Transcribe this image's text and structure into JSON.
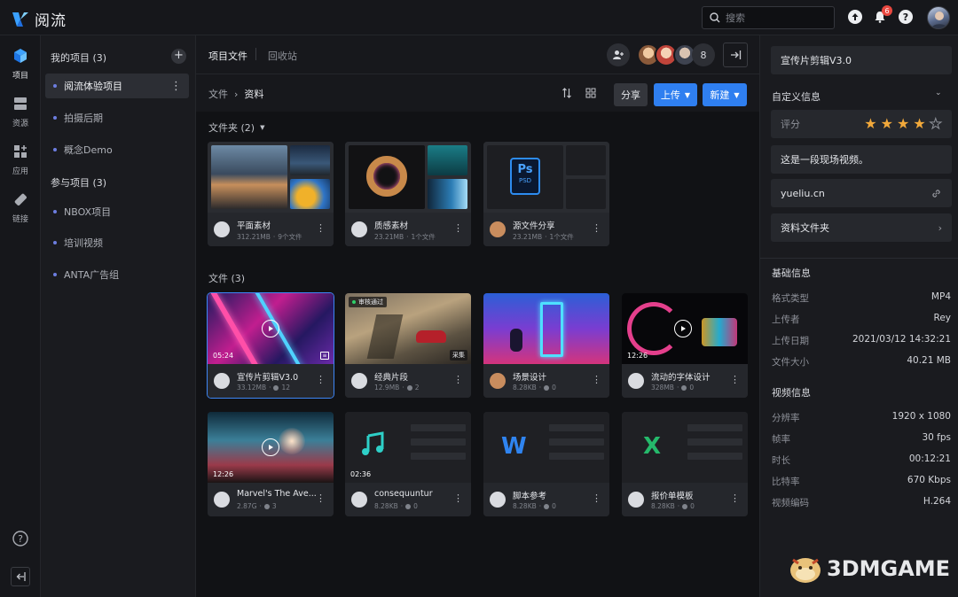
{
  "app": {
    "name": "阅流"
  },
  "search": {
    "placeholder": "搜索"
  },
  "notifications": {
    "count": "6"
  },
  "rail": {
    "items": [
      {
        "label": "项目"
      },
      {
        "label": "资源"
      },
      {
        "label": "应用"
      },
      {
        "label": "链接"
      }
    ]
  },
  "sidebar": {
    "my_projects_label": "我的项目 (3)",
    "my_projects": [
      {
        "label": "阅流体验项目"
      },
      {
        "label": "拍摄后期"
      },
      {
        "label": "概念Demo"
      }
    ],
    "joined_projects_label": "参与项目 (3)",
    "joined_projects": [
      {
        "label": "NBOX项目"
      },
      {
        "label": "培训视频"
      },
      {
        "label": "ANTA广告组"
      }
    ]
  },
  "main": {
    "tabs": [
      {
        "label": "项目文件"
      },
      {
        "label": "回收站"
      }
    ],
    "member_count": "8",
    "breadcrumb": {
      "root": "文件",
      "current": "资料"
    },
    "buttons": {
      "share": "分享",
      "upload": "上传",
      "create": "新建"
    },
    "folders_label": "文件夹 (2)",
    "folders": [
      {
        "name": "平面素材",
        "size": "312.21MB",
        "count": "9个文件"
      },
      {
        "name": "质感素材",
        "size": "23.21MB",
        "count": "1个文件"
      },
      {
        "name": "源文件分享",
        "size": "23.21MB",
        "count": "1个文件",
        "icon_label": "PSD"
      }
    ],
    "files_label": "文件 (3)",
    "files": [
      {
        "name": "宣传片剪辑V3.0",
        "size": "33.12MB",
        "comments": "12",
        "duration": "05:24"
      },
      {
        "name": "经典片段",
        "size": "12.9MB",
        "comments": "2",
        "tag": "审核通过",
        "tag2": "采集"
      },
      {
        "name": "场景设计",
        "size": "8.28KB",
        "comments": "0"
      },
      {
        "name": "流动的字体设计",
        "size": "328MB",
        "comments": "0",
        "duration": "12:26"
      },
      {
        "name": "Marvel's The Ave...",
        "size": "2.87G",
        "comments": "3",
        "duration": "12:26"
      },
      {
        "name": "consequuntur",
        "size": "8.28KB",
        "comments": "0",
        "duration": "02:36"
      },
      {
        "name": "脚本参考",
        "size": "8.28KB",
        "comments": "0"
      },
      {
        "name": "报价单模板",
        "size": "8.28KB",
        "comments": "0"
      }
    ]
  },
  "panel": {
    "title": "宣传片剪辑V3.0",
    "custom_info_label": "自定义信息",
    "rating_label": "评分",
    "rating": 4,
    "rating_max": 5,
    "description": "这是一段现场视频。",
    "link": "yueliu.cn",
    "folder": "资料文件夹",
    "basic_label": "基础信息",
    "basic": [
      {
        "k": "格式类型",
        "v": "MP4"
      },
      {
        "k": "上传者",
        "v": "Rey"
      },
      {
        "k": "上传日期",
        "v": "2021/03/12 14:32:21"
      },
      {
        "k": "文件大小",
        "v": "40.21 MB"
      }
    ],
    "video_label": "视频信息",
    "video": [
      {
        "k": "分辨率",
        "v": "1920 x 1080"
      },
      {
        "k": "帧率",
        "v": "30 fps"
      },
      {
        "k": "时长",
        "v": "00:12:21"
      },
      {
        "k": "比特率",
        "v": "670 Kbps"
      },
      {
        "k": "视频编码",
        "v": "H.264"
      }
    ]
  },
  "watermark": {
    "text": "3DMGAME"
  },
  "colors": {
    "accent": "#2f7ff0",
    "selection": "#3d86f5",
    "star": "#f2a93b",
    "badge": "#e8473f"
  }
}
